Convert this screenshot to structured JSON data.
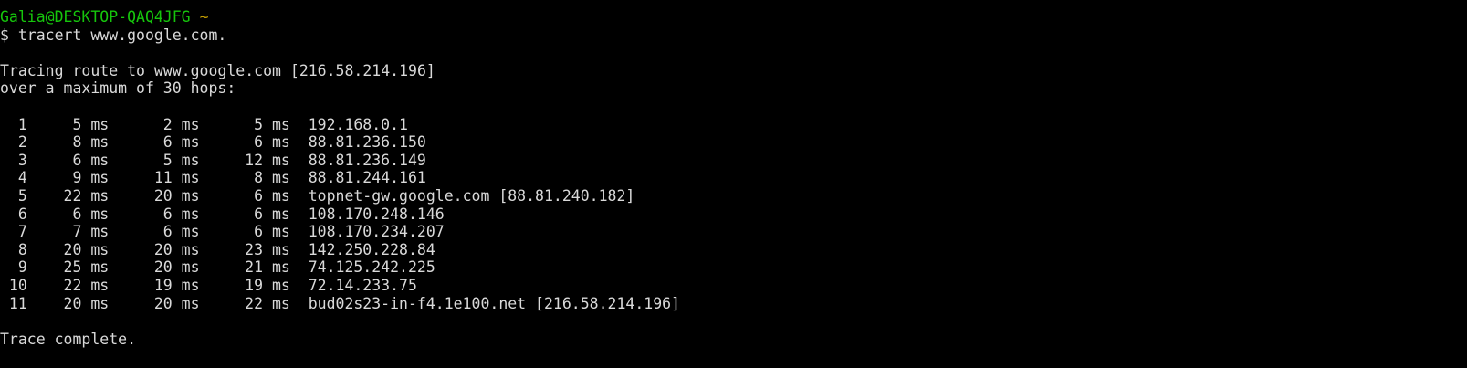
{
  "prompt": {
    "user_host": "Galia@DESKTOP-QAQ4JFG",
    "path": "~",
    "symbol": "$",
    "command": "tracert www.google.com."
  },
  "header": {
    "line1": "Tracing route to www.google.com [216.58.214.196]",
    "line2": "over a maximum of 30 hops:"
  },
  "unit": "ms",
  "hops": [
    {
      "n": "1",
      "t1": "5",
      "t2": "2",
      "t3": "5",
      "host": "192.168.0.1"
    },
    {
      "n": "2",
      "t1": "8",
      "t2": "6",
      "t3": "6",
      "host": "88.81.236.150"
    },
    {
      "n": "3",
      "t1": "6",
      "t2": "5",
      "t3": "12",
      "host": "88.81.236.149"
    },
    {
      "n": "4",
      "t1": "9",
      "t2": "11",
      "t3": "8",
      "host": "88.81.244.161"
    },
    {
      "n": "5",
      "t1": "22",
      "t2": "20",
      "t3": "6",
      "host": "topnet-gw.google.com [88.81.240.182]"
    },
    {
      "n": "6",
      "t1": "6",
      "t2": "6",
      "t3": "6",
      "host": "108.170.248.146"
    },
    {
      "n": "7",
      "t1": "7",
      "t2": "6",
      "t3": "6",
      "host": "108.170.234.207"
    },
    {
      "n": "8",
      "t1": "20",
      "t2": "20",
      "t3": "23",
      "host": "142.250.228.84"
    },
    {
      "n": "9",
      "t1": "25",
      "t2": "20",
      "t3": "21",
      "host": "74.125.242.225"
    },
    {
      "n": "10",
      "t1": "22",
      "t2": "19",
      "t3": "19",
      "host": "72.14.233.75"
    },
    {
      "n": "11",
      "t1": "20",
      "t2": "20",
      "t3": "22",
      "host": "bud02s23-in-f4.1e100.net [216.58.214.196]"
    }
  ],
  "footer": "Trace complete.",
  "colors": {
    "background": "#000000",
    "text": "#d9d9d9",
    "user_host": "#16c60c",
    "path": "#c19c00"
  }
}
